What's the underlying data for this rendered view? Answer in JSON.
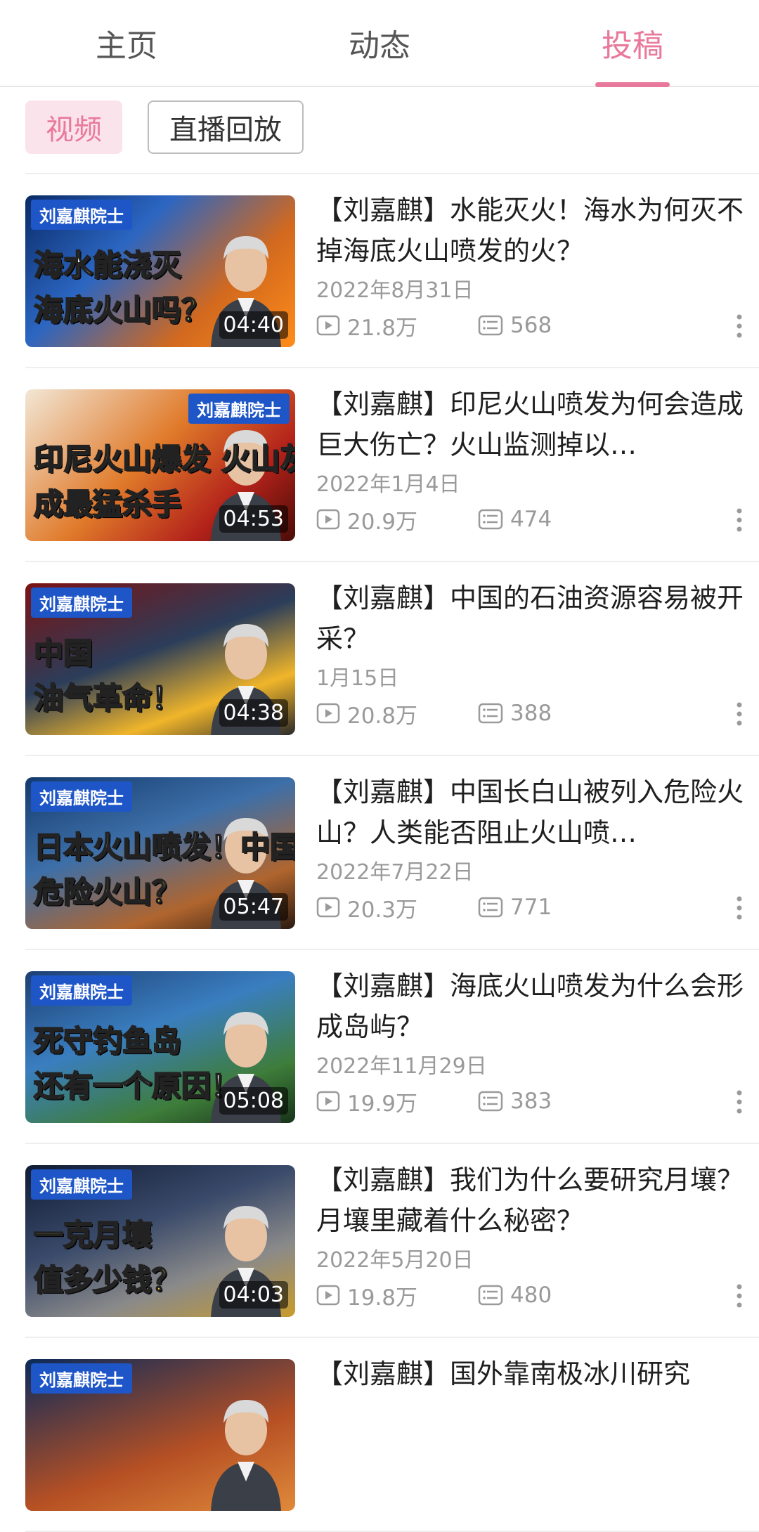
{
  "tabs": [
    {
      "label": "主页",
      "active": false
    },
    {
      "label": "动态",
      "active": false
    },
    {
      "label": "投稿",
      "active": true
    }
  ],
  "filters": [
    {
      "label": "视频",
      "active": true
    },
    {
      "label": "直播回放",
      "active": false
    }
  ],
  "accent_color": "#e9799c",
  "videos": [
    {
      "title": "【刘嘉麒】水能灭火！海水为何灭不掉海底火山喷发的火？",
      "date": "2022年8月31日",
      "plays": "21.8万",
      "comments": "568",
      "duration": "04:40",
      "thumb_badge": "刘嘉麒院士",
      "thumb_caption_1": "海水能浇灭",
      "thumb_caption_2": "海底火山吗？"
    },
    {
      "title": "【刘嘉麒】印尼火山喷发为何会造成巨大伤亡？火山监测掉以…",
      "date": "2022年1月4日",
      "plays": "20.9万",
      "comments": "474",
      "duration": "04:53",
      "thumb_badge": "刘嘉麒院士",
      "thumb_caption_1": "印尼火山爆发 火山灰",
      "thumb_caption_2": "成最猛杀手"
    },
    {
      "title": "【刘嘉麒】中国的石油资源容易被开采？",
      "date": "1月15日",
      "plays": "20.8万",
      "comments": "388",
      "duration": "04:38",
      "thumb_badge": "刘嘉麒院士",
      "thumb_caption_1": "中国",
      "thumb_caption_2": "油气革命！"
    },
    {
      "title": "【刘嘉麒】中国长白山被列入危险火山？人类能否阻止火山喷…",
      "date": "2022年7月22日",
      "plays": "20.3万",
      "comments": "771",
      "duration": "05:47",
      "thumb_badge": "刘嘉麒院士",
      "thumb_caption_1": "日本火山喷发！中国有哪些",
      "thumb_caption_2": "危险火山？"
    },
    {
      "title": "【刘嘉麒】海底火山喷发为什么会形成岛屿？",
      "date": "2022年11月29日",
      "plays": "19.9万",
      "comments": "383",
      "duration": "05:08",
      "thumb_badge": "刘嘉麒院士",
      "thumb_caption_1": "死守钓鱼岛",
      "thumb_caption_2": "还有一个原因！"
    },
    {
      "title": "【刘嘉麒】我们为什么要研究月壤？月壤里藏着什么秘密？",
      "date": "2022年5月20日",
      "plays": "19.8万",
      "comments": "480",
      "duration": "04:03",
      "thumb_badge": "刘嘉麒院士",
      "thumb_caption_1": "一克月壤",
      "thumb_caption_2": "值多少钱？"
    },
    {
      "title": "【刘嘉麒】国外靠南极冰川研究",
      "date": "",
      "plays": "",
      "comments": "",
      "duration": "",
      "thumb_badge": "刘嘉麒院士",
      "thumb_caption_1": "",
      "thumb_caption_2": ""
    }
  ]
}
